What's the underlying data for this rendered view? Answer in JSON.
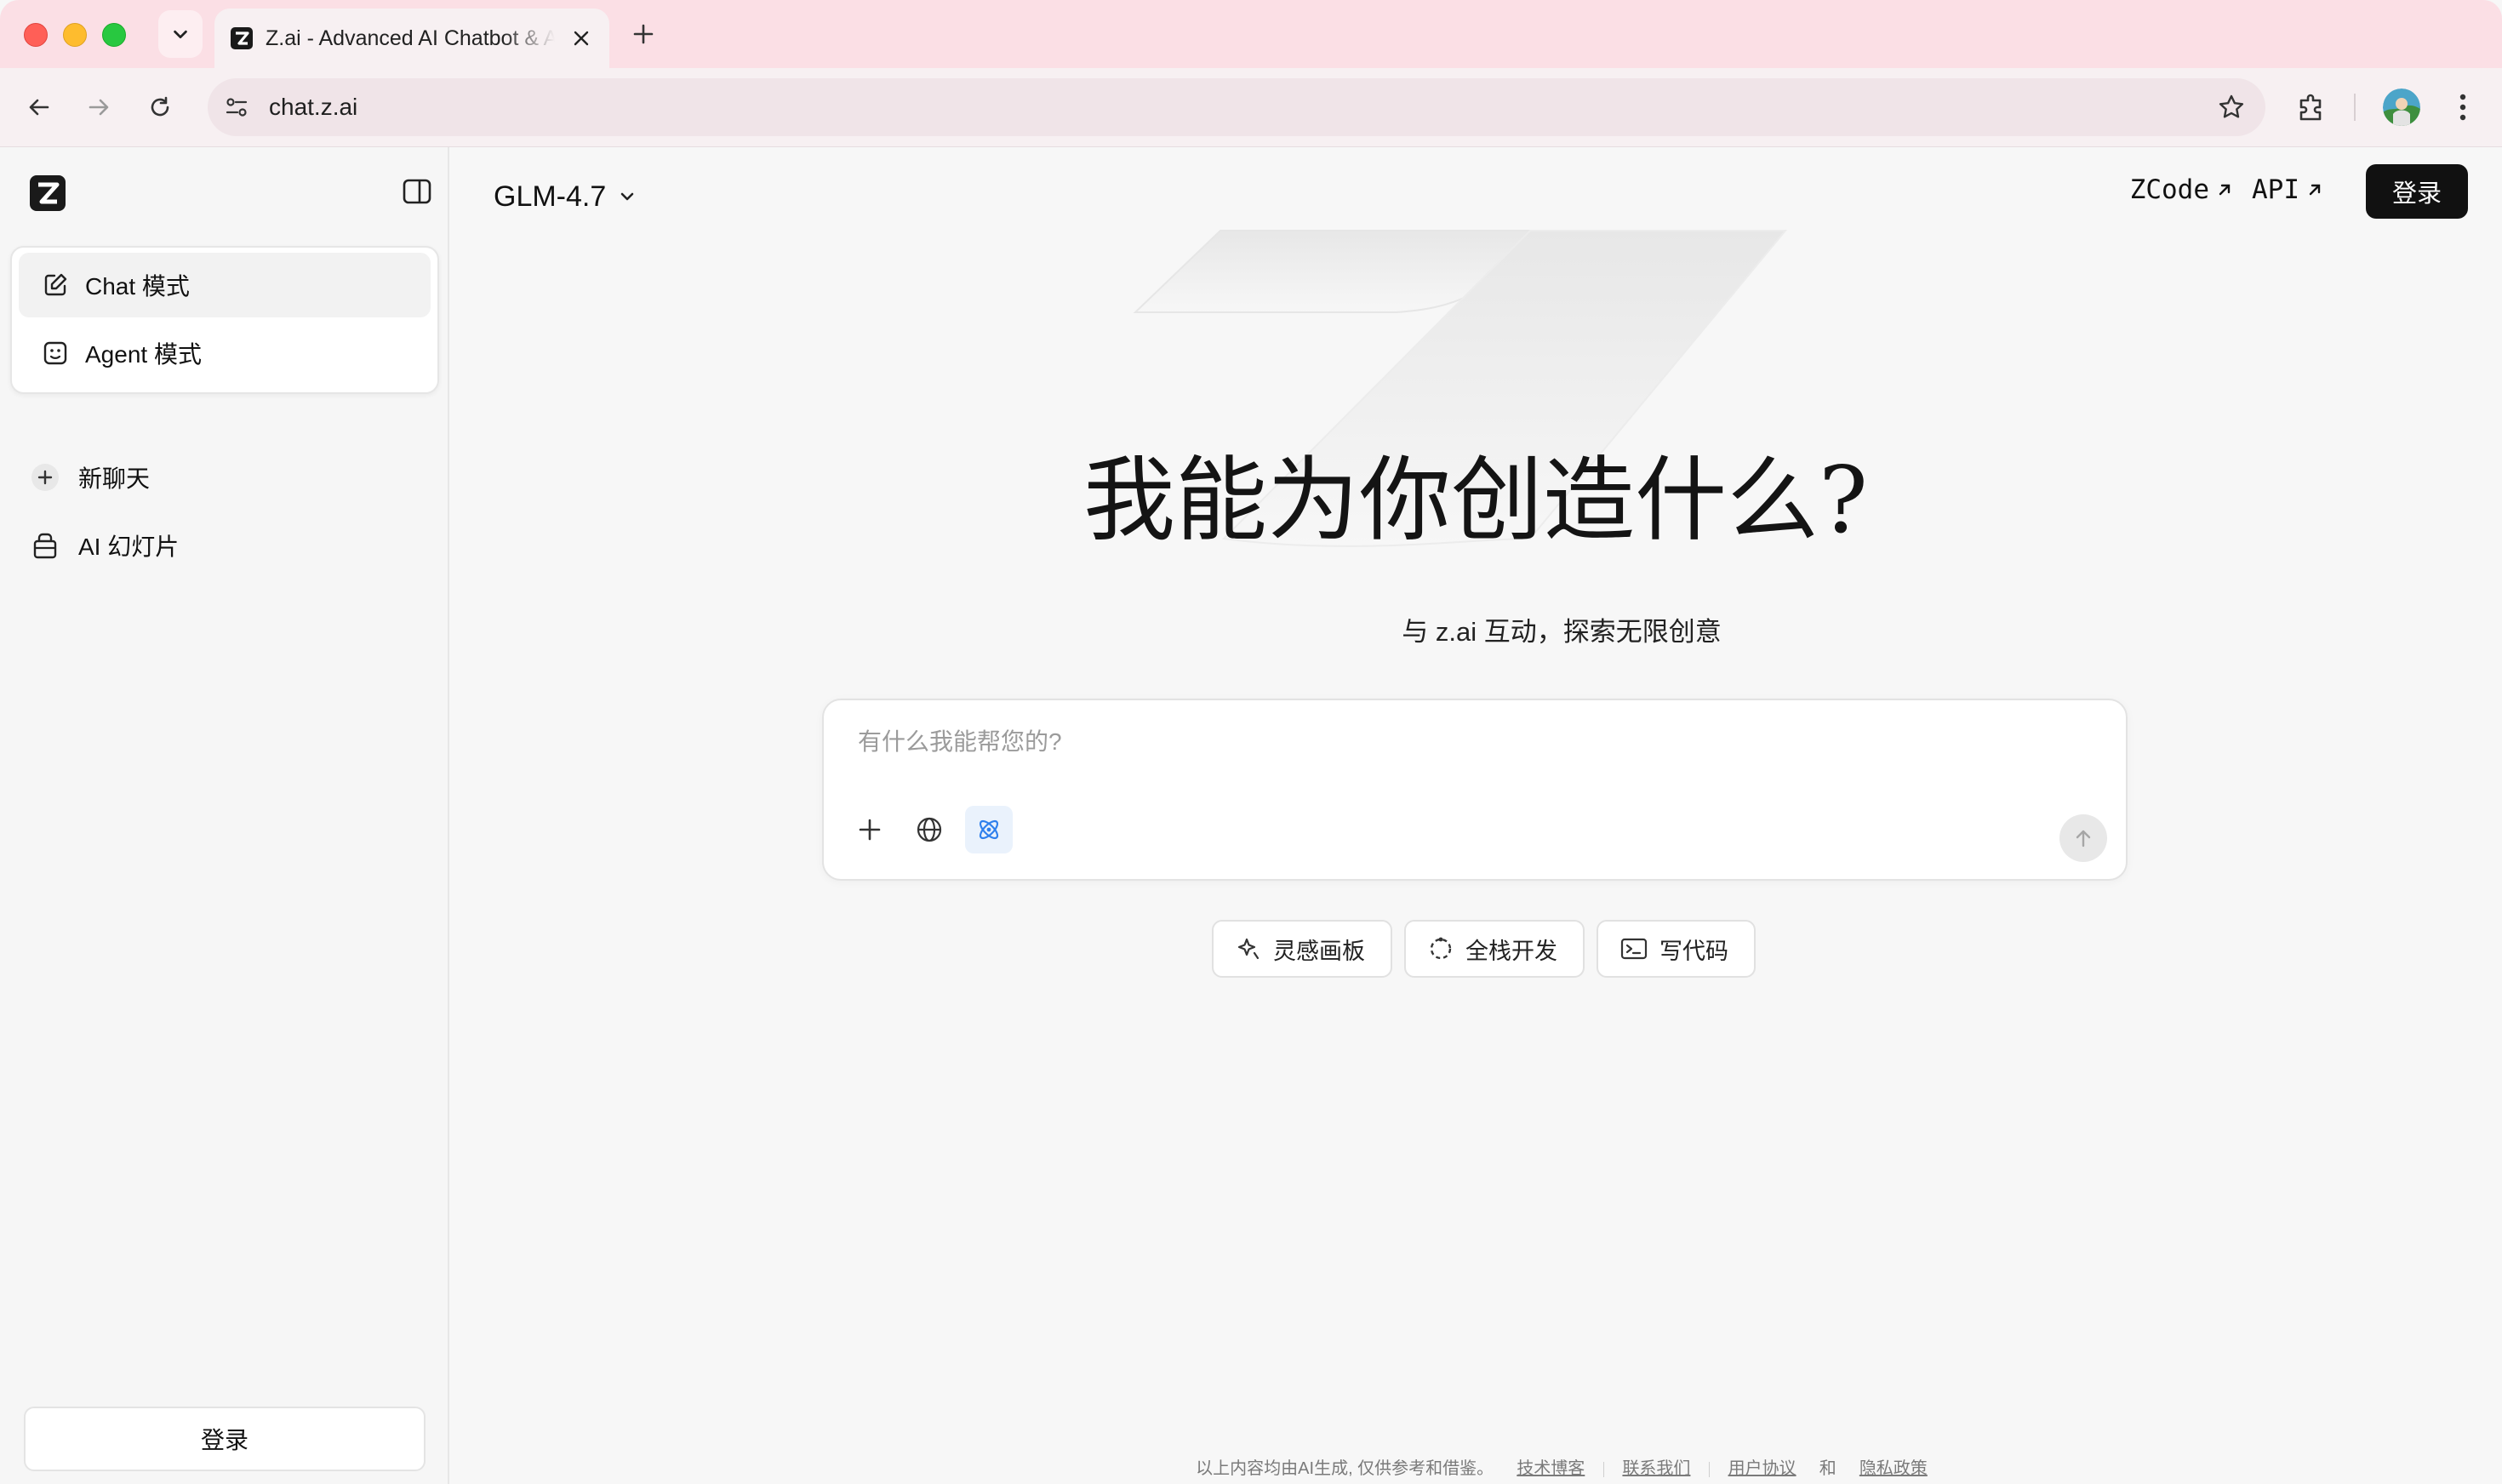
{
  "browser": {
    "tab_title": "Z.ai - Advanced AI Chatbot & AI Agent",
    "url": "chat.z.ai"
  },
  "sidebar": {
    "modes": [
      {
        "label": "Chat 模式",
        "icon": "edit-icon",
        "active": true
      },
      {
        "label": "Agent 模式",
        "icon": "agent-face-icon",
        "active": false
      }
    ],
    "new_chat": "新聊天",
    "ai_slides": "AI 幻灯片",
    "login": "登录"
  },
  "header": {
    "model": "GLM-4.7",
    "links": [
      {
        "label": "ZCode"
      },
      {
        "label": "API"
      }
    ],
    "login": "登录"
  },
  "hero": {
    "title": "我能为你创造什么?",
    "subtitle": "与 z.ai 互动，探索无限创意"
  },
  "chat": {
    "placeholder": "有什么我能帮您的?"
  },
  "chips": [
    {
      "label": "灵感画板",
      "icon": "sparkle-icon"
    },
    {
      "label": "全栈开发",
      "icon": "refresh-dashed-icon"
    },
    {
      "label": "写代码",
      "icon": "terminal-icon"
    }
  ],
  "footer": {
    "disclaimer": "以上内容均由AI生成, 仅供参考和借鉴。",
    "links": [
      "技术博客",
      "联系我们",
      "用户协议"
    ],
    "and": "和",
    "privacy": "隐私政策"
  },
  "colors": {
    "tabbar": "#fbdfe5",
    "accent_blue": "#2f80ed",
    "button_dark": "#111111"
  }
}
